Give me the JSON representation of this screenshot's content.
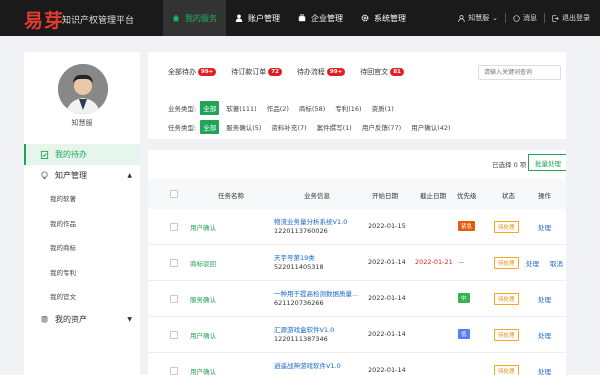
{
  "header": {
    "logo": "易芽",
    "app_name": "知识产权管理平台",
    "nav": [
      {
        "label": "我的服务",
        "icon": "home-icon"
      },
      {
        "label": "账户管理",
        "icon": "user-icon"
      },
      {
        "label": "企业管理",
        "icon": "briefcase-icon"
      },
      {
        "label": "系统管理",
        "icon": "gear-icon"
      }
    ],
    "user": "知慧服",
    "messages": "消息",
    "logout": "退出登录"
  },
  "sidebar": {
    "username": "知慧服",
    "items": [
      {
        "label": "我的待办"
      },
      {
        "label": "知产管理"
      },
      {
        "label": "我的资产"
      }
    ],
    "sub_items": [
      "我的软著",
      "我的作品",
      "我的商标",
      "我的专利",
      "我的官文"
    ]
  },
  "tabs": [
    {
      "label": "全部待办",
      "count": "99+"
    },
    {
      "label": "待订款订单",
      "count": "72"
    },
    {
      "label": "待办流程",
      "count": "99+"
    },
    {
      "label": "待回官文",
      "count": "81"
    }
  ],
  "search": {
    "placeholder": "请输入关键词查询"
  },
  "filters": {
    "business": {
      "label": "业务类型:",
      "all": "全部",
      "options": [
        "软著(111)",
        "作品(2)",
        "商标(58)",
        "专利(16)",
        "资质(1)"
      ]
    },
    "task": {
      "label": "任务类型:",
      "all": "全部",
      "options": [
        "服务确认(5)",
        "资料补充(7)",
        "案件撰写(1)",
        "用户反馈(77)",
        "用户确认(42)"
      ]
    }
  },
  "toolbar": {
    "selected": "已选择 0 项",
    "batch": "批量处理"
  },
  "table": {
    "headers": [
      "任务名称",
      "业务信息",
      "开始日期",
      "截止日期",
      "优先级",
      "状态",
      "操作"
    ],
    "rows": [
      {
        "task": "用户确认",
        "biz_name": "物流业务量分析系统V1.0",
        "biz_id": "1220113760026",
        "start": "2022-01-15",
        "end": "",
        "priority": "紧急",
        "pcolor": "#e8590c",
        "status": "待处理",
        "actions": [
          "处理"
        ]
      },
      {
        "task": "商标驳回",
        "biz_name": "天宇号第19类",
        "biz_id": "522011405318",
        "start": "2022-01-14",
        "end": "2022-01-21",
        "priority": "--",
        "pcolor": "",
        "status": "待处理",
        "actions": [
          "处理",
          "取消"
        ]
      },
      {
        "task": "服务确认",
        "biz_name": "一种用于提高检测数据质量...",
        "biz_id": "621120736266",
        "start": "2022-01-14",
        "end": "",
        "priority": "中",
        "pcolor": "#37b24d",
        "status": "待处理",
        "actions": [
          "处理"
        ]
      },
      {
        "task": "用户确认",
        "biz_name": "汇源游戏盒软件V1.0",
        "biz_id": "1220111387346",
        "start": "2022-01-14",
        "end": "",
        "priority": "低",
        "pcolor": "#5c7cfa",
        "status": "待处理",
        "actions": [
          "处理"
        ]
      },
      {
        "task": "用户确认",
        "biz_name": "逍遥战神游戏软件V1.0",
        "biz_id": "",
        "start": "2022-01-14",
        "end": "",
        "priority": "",
        "pcolor": "",
        "status": "待处理",
        "actions": [
          "处理"
        ]
      }
    ]
  }
}
